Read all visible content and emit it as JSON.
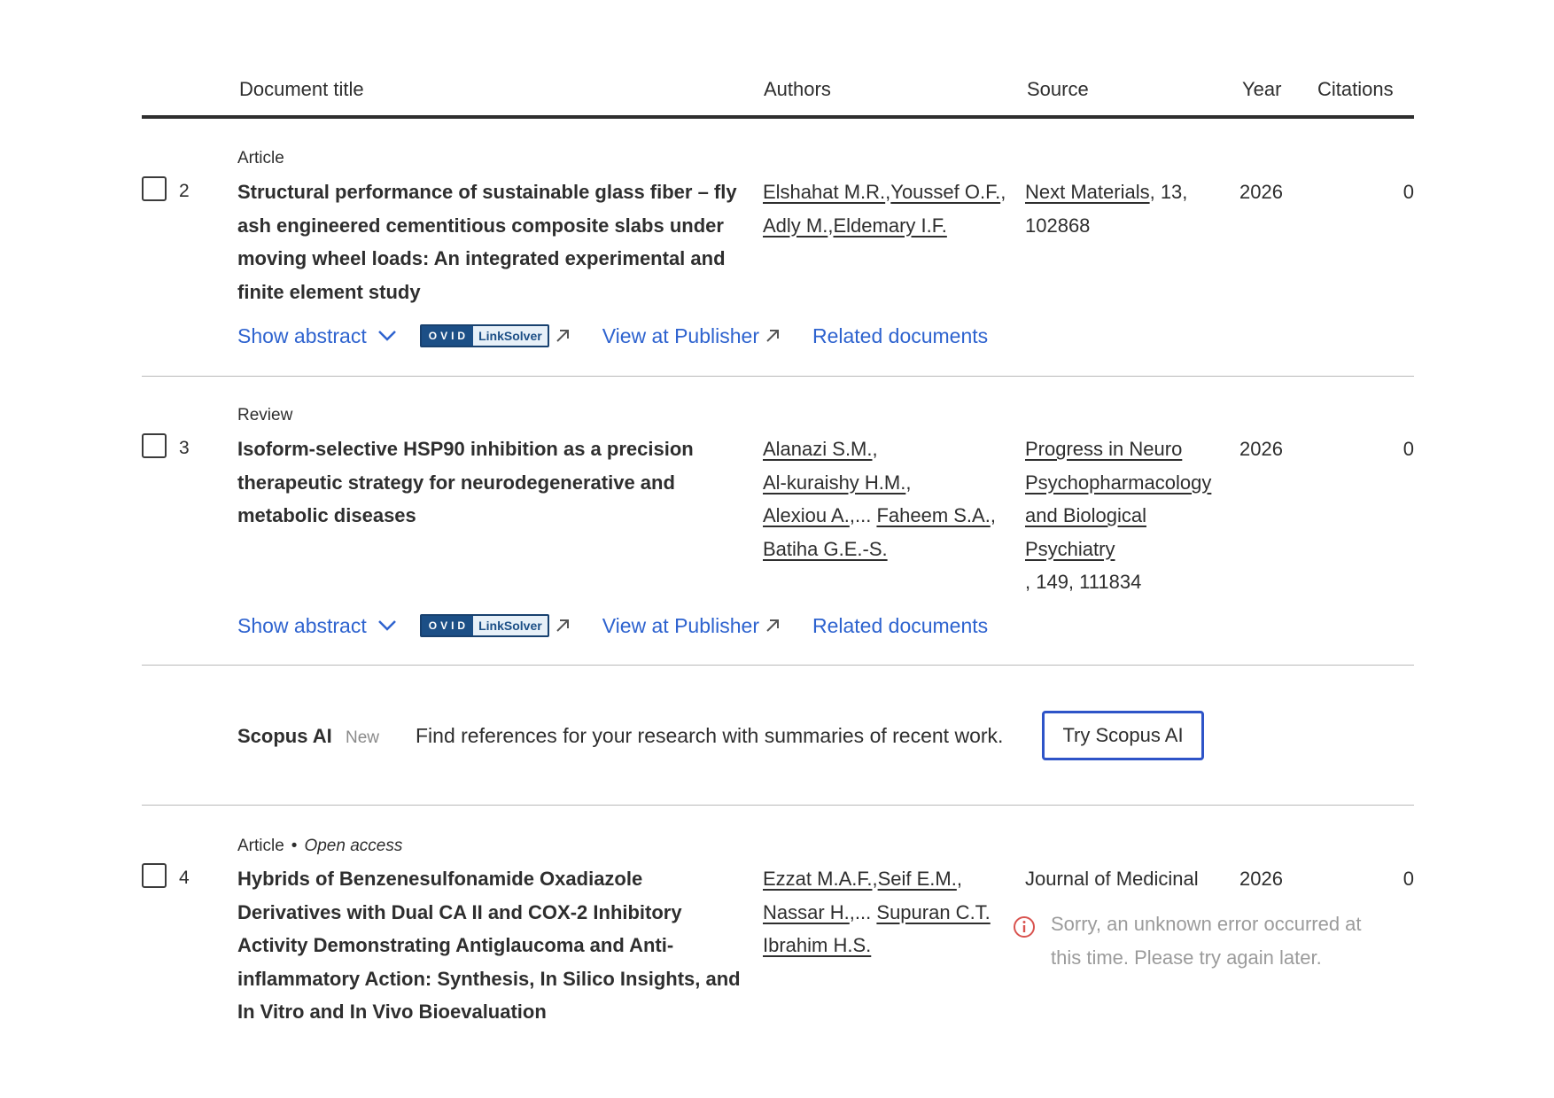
{
  "columns": {
    "title": "Document title",
    "authors": "Authors",
    "source": "Source",
    "year": "Year",
    "citations": "Citations"
  },
  "rows": [
    {
      "number": "2",
      "type": "Article",
      "title_lines": [
        "Structural performance of sustainable glass fiber – fly",
        "ash engineered cementitious composite slabs under",
        "moving wheel loads: An integrated experimental and",
        "finite element study"
      ],
      "authors": [
        "Elshahat M.R.",
        "Youssef O.F.",
        "Adly M.",
        "Eldemary I.F."
      ],
      "source_name": "Next Materials",
      "source_line1_suffix": ", 13,",
      "source_line2": "102868",
      "year": "2026",
      "citations": "0",
      "actions": {
        "show_abstract": "Show abstract",
        "ovid_left": "OVID",
        "ovid_right": "LinkSolver",
        "view_publisher": "View at Publisher",
        "related": "Related documents"
      }
    },
    {
      "number": "3",
      "type": "Review",
      "title_lines": [
        "Isoform-selective HSP90 inhibition as a precision",
        "therapeutic strategy for neurodegenerative and",
        "metabolic diseases"
      ],
      "authors": [
        "Alanazi S.M.",
        "Al-kuraishy H.M.",
        "Alexiou A.",
        "Faheem S.A.",
        "Batiha G.E.-S."
      ],
      "authors_ellipsis": "...",
      "source_lines": [
        "Progress in Neuro",
        "Psychopharmacology",
        "and Biological",
        "Psychiatry"
      ],
      "source_suffix": ", 149, 111834",
      "year": "2026",
      "citations": "0",
      "actions": {
        "show_abstract": "Show abstract",
        "ovid_left": "OVID",
        "ovid_right": "LinkSolver",
        "view_publisher": "View at Publisher",
        "related": "Related documents"
      }
    },
    {
      "number": "4",
      "type": "Article",
      "access": "Open access",
      "title_lines": [
        "Hybrids of Benzenesulfonamide Oxadiazole",
        "Derivatives with Dual CA II and COX-2 Inhibitory",
        "Activity Demonstrating Antiglaucoma and Anti-",
        "inflammatory Action: Synthesis, In Silico Insights, and",
        "In Vitro and In Vivo Bioevaluation"
      ],
      "authors": [
        "Ezzat M.A.F.",
        "Seif E.M.",
        "Nassar H.",
        "Supuran C.T.",
        "Ibrahim H.S."
      ],
      "authors_ellipsis": "...",
      "source_name": "Journal of Medicinal",
      "year": "2026",
      "citations": "0",
      "error": "Sorry, an unknown error occurred at this time. Please try again later."
    }
  ],
  "scopus_ai": {
    "title": "Scopus AI",
    "badge": "New",
    "description": "Find references for your research with summaries of recent work.",
    "button": "Try Scopus AI"
  },
  "colors": {
    "link": "#2e63cf",
    "button_border": "#2e54c8",
    "error": "#d9534f",
    "muted": "#9b9b9b"
  }
}
